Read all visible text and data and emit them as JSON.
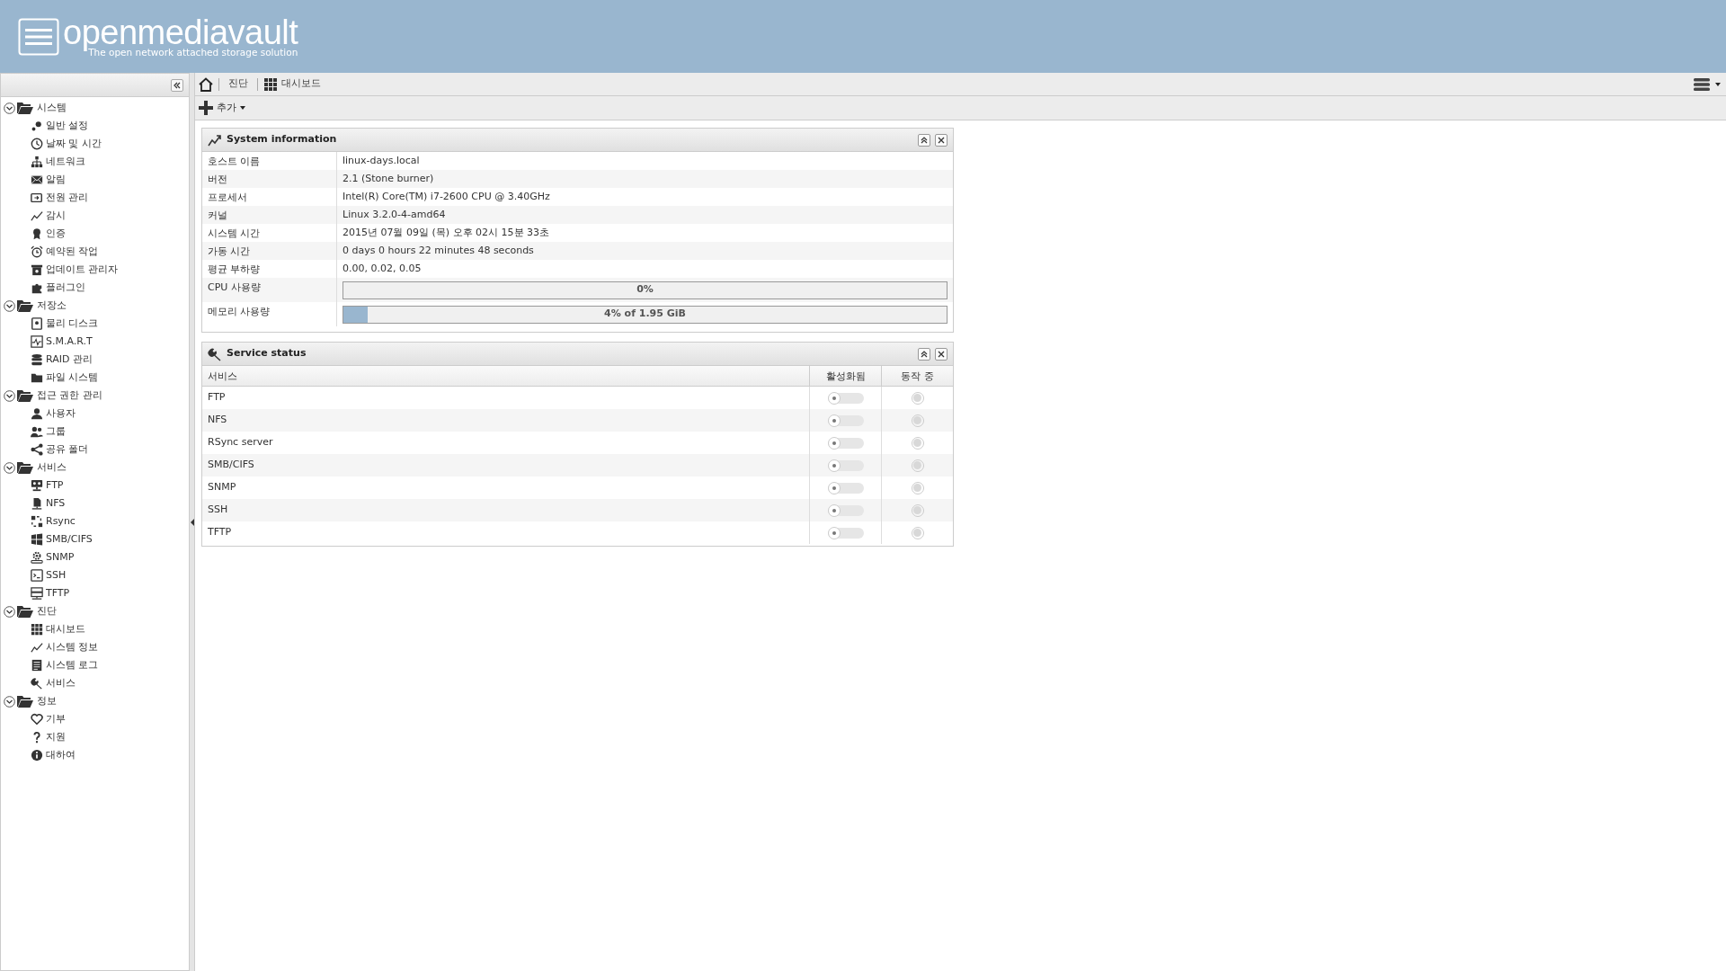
{
  "header": {
    "logo": "openmediavault",
    "tagline": "The open network attached storage solution"
  },
  "sidebar": {
    "items": [
      {
        "label": "시스템",
        "expanded": true,
        "children": [
          {
            "label": "일반 설정"
          },
          {
            "label": "날짜 및 시간"
          },
          {
            "label": "네트워크"
          },
          {
            "label": "알림"
          },
          {
            "label": "전원 관리"
          },
          {
            "label": "감시"
          },
          {
            "label": "인증"
          },
          {
            "label": "예약된 작업"
          },
          {
            "label": "업데이트 관리자"
          },
          {
            "label": "플러그인"
          }
        ]
      },
      {
        "label": "저장소",
        "expanded": true,
        "children": [
          {
            "label": "물리 디스크"
          },
          {
            "label": "S.M.A.R.T"
          },
          {
            "label": "RAID 관리"
          },
          {
            "label": "파일 시스템"
          }
        ]
      },
      {
        "label": "접근 권한 관리",
        "expanded": true,
        "children": [
          {
            "label": "사용자"
          },
          {
            "label": "그룹"
          },
          {
            "label": "공유 폴더"
          }
        ]
      },
      {
        "label": "서비스",
        "expanded": true,
        "children": [
          {
            "label": "FTP"
          },
          {
            "label": "NFS"
          },
          {
            "label": "Rsync"
          },
          {
            "label": "SMB/CIFS"
          },
          {
            "label": "SNMP"
          },
          {
            "label": "SSH"
          },
          {
            "label": "TFTP"
          }
        ]
      },
      {
        "label": "진단",
        "expanded": true,
        "children": [
          {
            "label": "대시보드"
          },
          {
            "label": "시스템 정보"
          },
          {
            "label": "시스템 로그"
          },
          {
            "label": "서비스"
          }
        ]
      },
      {
        "label": "정보",
        "expanded": true,
        "children": [
          {
            "label": "기부"
          },
          {
            "label": "지원"
          },
          {
            "label": "대하여"
          }
        ]
      }
    ]
  },
  "breadcrumb": [
    "진단",
    "대시보드"
  ],
  "toolbar": {
    "add_button": "추가"
  },
  "system_information": {
    "title": "System information",
    "rows": [
      {
        "kind": "text",
        "label": "호스트 이름",
        "value": "linux-days.local"
      },
      {
        "kind": "text",
        "label": "버전",
        "value": "2.1 (Stone burner)"
      },
      {
        "kind": "text",
        "label": "프로세서",
        "value": "Intel(R) Core(TM) i7-2600 CPU @ 3.40GHz"
      },
      {
        "kind": "text",
        "label": "커널",
        "value": "Linux 3.2.0-4-amd64"
      },
      {
        "kind": "text",
        "label": "시스템 시간",
        "value": "2015년 07월 09일 (목) 오후 02시 15분 33초"
      },
      {
        "kind": "text",
        "label": "가동 시간",
        "value": "0 days 0 hours 22 minutes 48 seconds"
      },
      {
        "kind": "text",
        "label": "평균 부하량",
        "value": "0.00, 0.02, 0.05"
      },
      {
        "kind": "progress",
        "label": "CPU 사용량",
        "level": 0,
        "reading": "0%"
      },
      {
        "kind": "progress",
        "label": "메모리 사용량",
        "level": 0.04,
        "reading": "4% of 1.95 GiB"
      }
    ]
  },
  "service_status": {
    "title": "Service status",
    "columns": [
      "서비스",
      "활성화됨",
      "동작 중"
    ],
    "rows": [
      {
        "name": "FTP",
        "enabled": false,
        "running": false
      },
      {
        "name": "NFS",
        "enabled": false,
        "running": false
      },
      {
        "name": "RSync server",
        "enabled": false,
        "running": false
      },
      {
        "name": "SMB/CIFS",
        "enabled": false,
        "running": false
      },
      {
        "name": "SNMP",
        "enabled": false,
        "running": false
      },
      {
        "name": "SSH",
        "enabled": false,
        "running": false
      },
      {
        "name": "TFTP",
        "enabled": false,
        "running": false
      }
    ]
  }
}
